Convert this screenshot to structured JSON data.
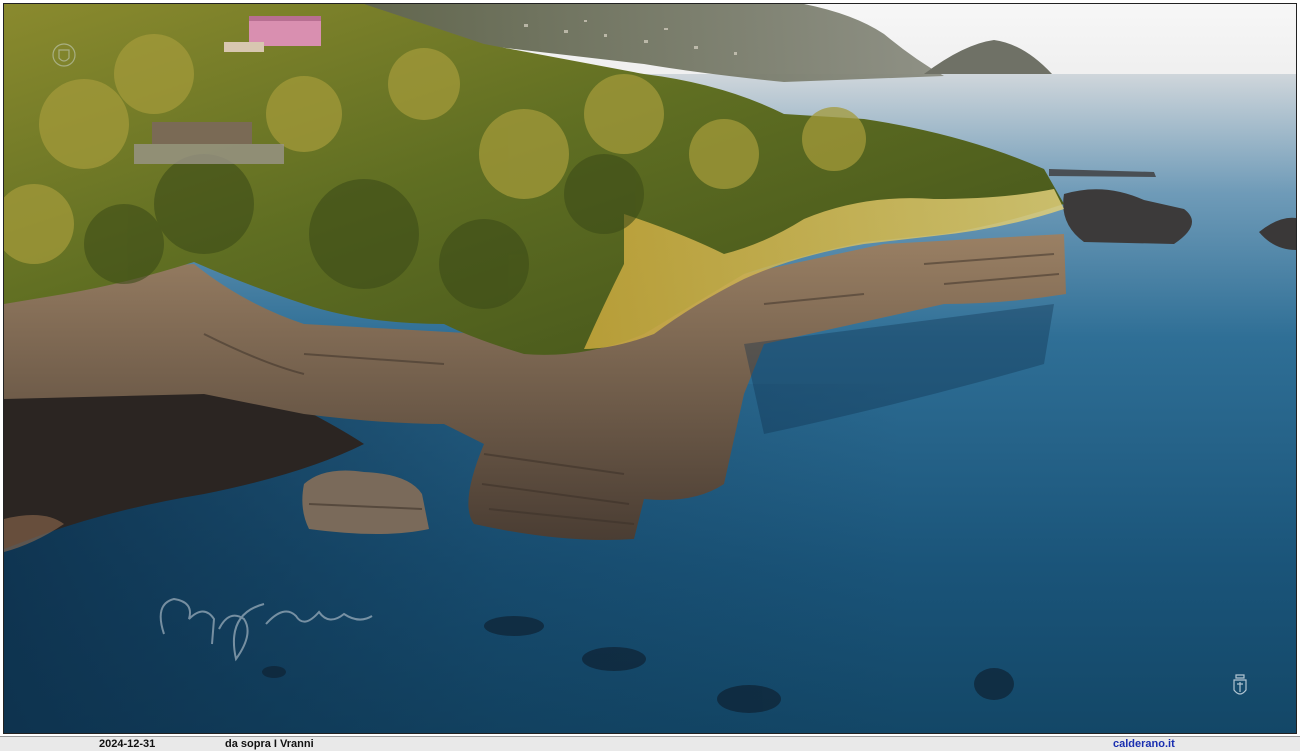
{
  "caption": {
    "date": "2024-12-31",
    "title": "da sopra I Vranni",
    "site": "calderano.it"
  },
  "colors": {
    "sea_deep": "#0f3b5c",
    "sea_mid": "#1f5f86",
    "sky": "#f2f2f2",
    "vegetation": "#6b7a2a",
    "vegetation_lit": "#c8b24a",
    "rock": "#6d5e4e",
    "beach": "#2b2522",
    "caption_bg": "#e9e9e9",
    "link": "#1a2fb0"
  },
  "icons": {
    "signature_watermark": "handwritten-signature",
    "crest_logo": "coat-of-arms-icon"
  }
}
